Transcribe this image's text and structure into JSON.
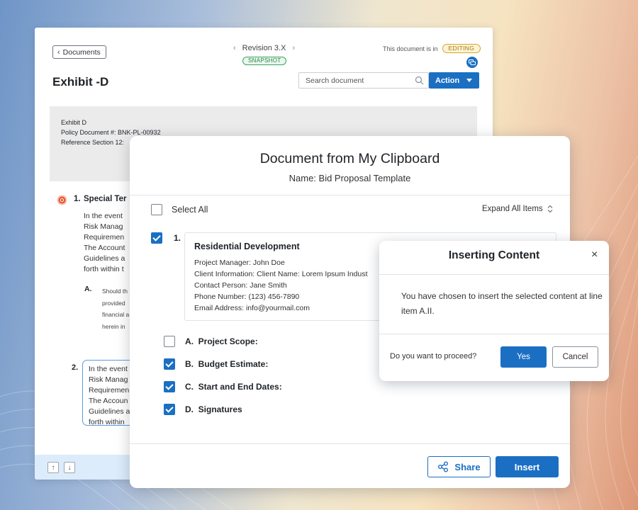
{
  "document": {
    "back_label": "Documents",
    "revision_label": "Revision 3.X",
    "snapshot_badge": "SNAPSHOT",
    "state_prefix": "This document is in",
    "state_badge": "EDITING",
    "title": "Exhibit -D",
    "search_placeholder": "Search document",
    "action_label": "Action",
    "meta_lines": [
      "Exhibit D",
      "Policy Document #: BNK-PL-00932",
      "Reference Section 12:"
    ],
    "section1": {
      "number": "1.",
      "heading": "Special Ter",
      "lines": [
        "In the event",
        "Risk Manag",
        "Requiremen",
        "The Account",
        "Guidelines a",
        "forth within t"
      ]
    },
    "subsectionA": {
      "label": "A.",
      "lines": [
        "Should th",
        "provided",
        "financial a",
        "herein in"
      ]
    },
    "section2": {
      "number": "2.",
      "lines": [
        "In the event",
        "Risk Manag",
        "Requiremen",
        "The Accoun",
        "Guidelines a",
        "forth within"
      ]
    },
    "footer": {
      "up_arrow": "↑",
      "down_arrow": "↓"
    }
  },
  "clipboard": {
    "title": "Document from My Clipboard",
    "subtitle": "Name: Bid Proposal Template",
    "select_all_label": "Select All",
    "expand_all_label": "Expand All Items",
    "item": {
      "number": "1.",
      "title": "Residential Development",
      "lines": [
        "Project Manager: John Doe",
        "Client Information: Client Name: Lorem Ipsum Indust",
        "Contact Person: Jane Smith",
        "Phone Number: (123) 456-7890",
        "Email Address: info@yourmail.com"
      ]
    },
    "subitems": [
      {
        "letter": "A.",
        "label": "Project Scope:",
        "checked": false
      },
      {
        "letter": "B.",
        "label": "Budget Estimate:",
        "checked": true
      },
      {
        "letter": "C.",
        "label": "Start and End Dates:",
        "checked": true
      },
      {
        "letter": "D.",
        "label": "Signatures",
        "checked": true
      }
    ],
    "share_label": "Share",
    "insert_label": "Insert"
  },
  "modal": {
    "title": "Inserting Content",
    "close_glyph": "×",
    "body_text": "You have chosen to insert the selected content at line item A.II.",
    "question": "Do you want to proceed?",
    "yes_label": "Yes",
    "cancel_label": "Cancel"
  },
  "colors": {
    "primary": "#1b6fc3",
    "snapshot_green": "#2a8a45",
    "editing_amber": "#a57a10",
    "alert_orange": "#e4572e"
  },
  "icons": [
    "chevron-left-icon",
    "chevron-right-icon",
    "chat-icon",
    "search-icon",
    "caret-down-icon",
    "alert-icon",
    "sort-icon",
    "share-icon",
    "close-icon",
    "arrow-up-icon",
    "arrow-down-icon",
    "checkbox-icon"
  ]
}
